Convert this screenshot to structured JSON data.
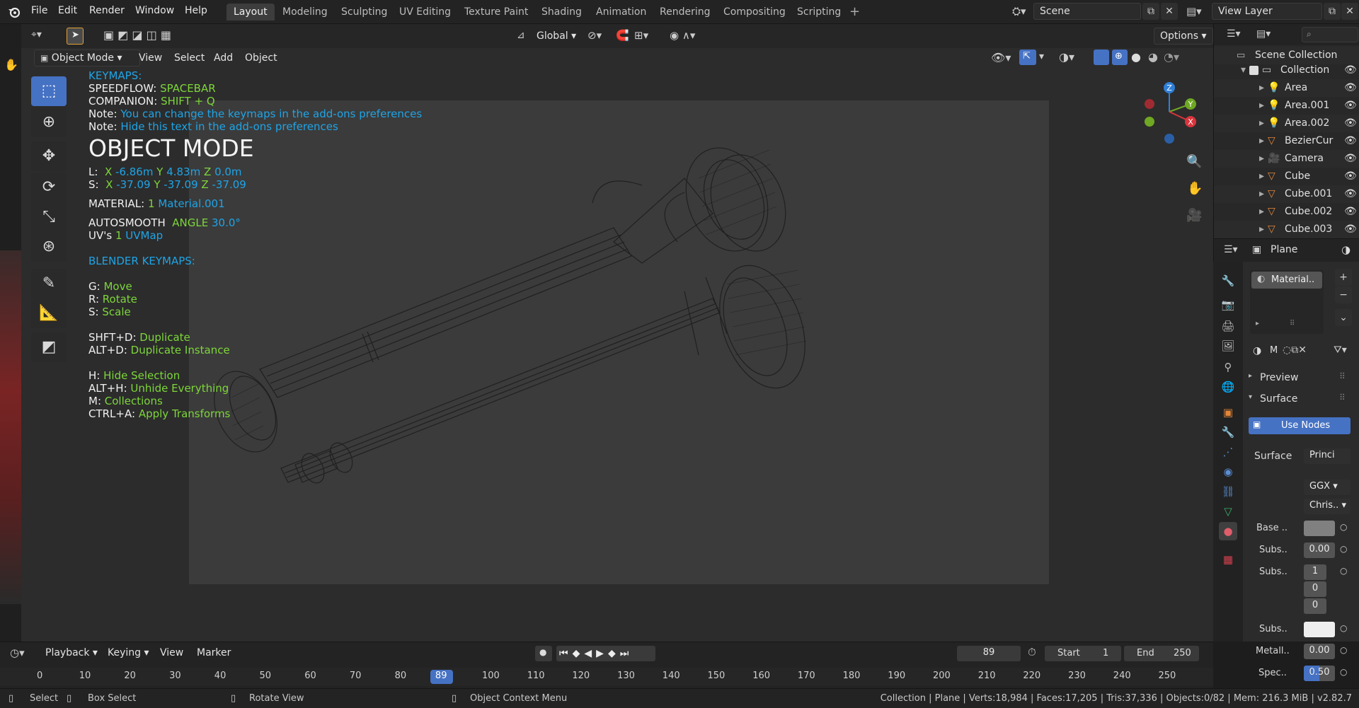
{
  "menu": [
    "File",
    "Edit",
    "Render",
    "Window",
    "Help"
  ],
  "workspaces": [
    "Layout",
    "Modeling",
    "Sculpting",
    "UV Editing",
    "Texture Paint",
    "Shading",
    "Animation",
    "Rendering",
    "Compositing",
    "Scripting"
  ],
  "active_workspace": "Layout",
  "scene": "Scene",
  "view_layer": "View Layer",
  "viewport_header": {
    "mode": "Object Mode",
    "menus": [
      "View",
      "Select",
      "Add",
      "Object"
    ],
    "transform_orientation": "Global",
    "options": "Options"
  },
  "overlay": {
    "keymaps_title": "KEYMAPS:",
    "speedflow_label": "SPEEDFLOW:",
    "speedflow_key": "SPACEBAR",
    "companion_label": "COMPANION:",
    "companion_key": "SHIFT + Q",
    "note_label": "Note:",
    "note1": "You can change the keymaps in the add-ons preferences",
    "note2": "Hide this text in the add-ons preferences",
    "mode_title": "OBJECT MODE",
    "loc_label": "L:",
    "loc_x_label": "X",
    "loc_x": "-6.86m",
    "loc_y_label": "Y",
    "loc_y": "4.83m",
    "loc_z_label": "Z",
    "loc_z": "0.0m",
    "scale_label": "S:",
    "scale_x_label": "X",
    "scale_x": "-37.09",
    "scale_y_label": "Y",
    "scale_y": "-37.09",
    "scale_z_label": "Z",
    "scale_z": "-37.09",
    "material_label": "MATERIAL:",
    "material_count": "1",
    "material_name": "Material.001",
    "autosmooth_label": "AUTOSMOOTH",
    "angle_label": "ANGLE",
    "angle_value": "30.0°",
    "uvs_label": "UV's",
    "uvs_count": "1",
    "uvs_name": "UVMap",
    "blender_keymaps_title": "BLENDER KEYMAPS:",
    "keys": [
      {
        "key": "G:",
        "action": "Move"
      },
      {
        "key": "R:",
        "action": "Rotate"
      },
      {
        "key": "S:",
        "action": "Scale"
      },
      {
        "key": "SHFT+D:",
        "action": "Duplicate"
      },
      {
        "key": "ALT+D:",
        "action": "Duplicate Instance"
      },
      {
        "key": "H:",
        "action": "Hide Selection"
      },
      {
        "key": "ALT+H:",
        "action": "Unhide Everything"
      },
      {
        "key": "M:",
        "action": "Collections"
      },
      {
        "key": "CTRL+A:",
        "action": "Apply Transforms"
      }
    ]
  },
  "gizmo": {
    "z": "Z",
    "y": "Y",
    "x": "X"
  },
  "outliner": {
    "root": "Scene Collection",
    "items": [
      "Collection",
      "Area",
      "Area.001",
      "Area.002",
      "BezierCur",
      "Camera",
      "Cube",
      "Cube.001",
      "Cube.002",
      "Cube.003"
    ]
  },
  "properties": {
    "object_name": "Plane",
    "material_slot": "Material..",
    "material_short": "M",
    "preview": "Preview",
    "surface": "Surface",
    "use_nodes": "Use Nodes",
    "surface_label": "Surface",
    "surface_value": "Princi",
    "distribution": "GGX",
    "subsurface_method": "Chris..",
    "base_label": "Base ..",
    "subs1_label": "Subs..",
    "subs1_value": "0.00",
    "subs2_label": "Subs..",
    "subs2_values": [
      "1",
      "0",
      "0"
    ],
    "subs3_label": "Subs..",
    "metal_label": "Metall..",
    "metal_value": "0.00",
    "spec_label": "Spec..",
    "spec_value": "0.50"
  },
  "timeline": {
    "menus": [
      "Playback",
      "Keying",
      "View",
      "Marker"
    ],
    "current_frame": "89",
    "start_label": "Start",
    "start": "1",
    "end_label": "End",
    "end": "250",
    "ticks": [
      "0",
      "10",
      "20",
      "30",
      "40",
      "50",
      "60",
      "70",
      "80",
      "89",
      "100",
      "110",
      "120",
      "130",
      "140",
      "150",
      "160",
      "170",
      "180",
      "190",
      "200",
      "210",
      "220",
      "230",
      "240",
      "250"
    ]
  },
  "statusbar": {
    "select": "Select",
    "box_select": "Box Select",
    "rotate_view": "Rotate View",
    "context_menu": "Object Context Menu",
    "stats": "Collection | Plane | Verts:18,984 | Faces:17,205 | Tris:37,336 | Objects:0/82 | Mem: 216.3 MiB | v2.82.7"
  },
  "colors": {
    "accent_blue": "#4672c4",
    "overlay_blue": "#1fa4e6",
    "overlay_green": "#7dd63a",
    "frame_marker": "#4672c4"
  }
}
